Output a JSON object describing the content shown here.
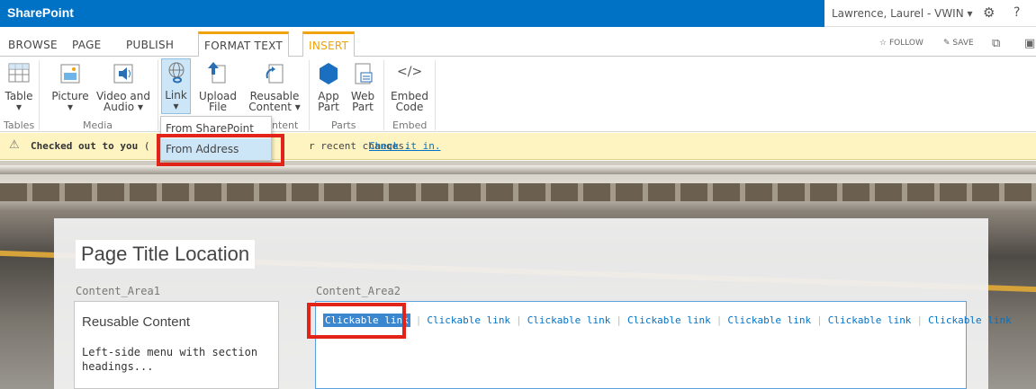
{
  "topbar": {
    "brand": "SharePoint",
    "user": "Lawrence, Laurel - VWIN",
    "user_caret": "▾",
    "gear": "⚙",
    "help": "?"
  },
  "tabs": {
    "items": [
      "BROWSE",
      "PAGE",
      "PUBLISH",
      "FORMAT TEXT",
      "INSERT"
    ],
    "follow": "FOLLOW",
    "save": "SAVE"
  },
  "ribbon": {
    "buttons": {
      "table": "Table",
      "picture": "Picture",
      "video": "Video and",
      "video2": "Audio ▾",
      "link": "Link",
      "link_caret": "▾",
      "upload": "Upload",
      "upload2": "File",
      "reusable": "Reusable",
      "reusable2": "Content ▾",
      "apppart": "App",
      "apppart2": "Part",
      "webpart": "Web",
      "webpart2": "Part",
      "embed": "Embed",
      "embed2": "Code",
      "table_caret": "▾",
      "picture_caret": "▾",
      "embed_glyph": "</>"
    },
    "groups": {
      "tables": "Tables",
      "media": "Media",
      "content": "ntent",
      "parts": "Parts",
      "embed": "Embed"
    }
  },
  "dropdown": {
    "item1": "From SharePoint",
    "item2": "From Address"
  },
  "notice": {
    "msg": "Checked out to you",
    "msg_tail": "(",
    "msg2": "r recent changes.",
    "link": "Check it in."
  },
  "page": {
    "title": "Page Title Location",
    "area1_label": "Content_Area1",
    "area2_label": "Content_Area2",
    "reusable_heading": "Reusable Content",
    "reusable_text": "Left-side menu with section headings..."
  },
  "links": [
    "Clickable link",
    "Clickable link",
    "Clickable link",
    "Clickable link",
    "Clickable link",
    "Clickable link",
    "Clickable link"
  ],
  "colors": {
    "topbar": "#0072c6",
    "accent": "#f0a30a",
    "highlight": "#e2231a",
    "link": "#0072c6"
  }
}
